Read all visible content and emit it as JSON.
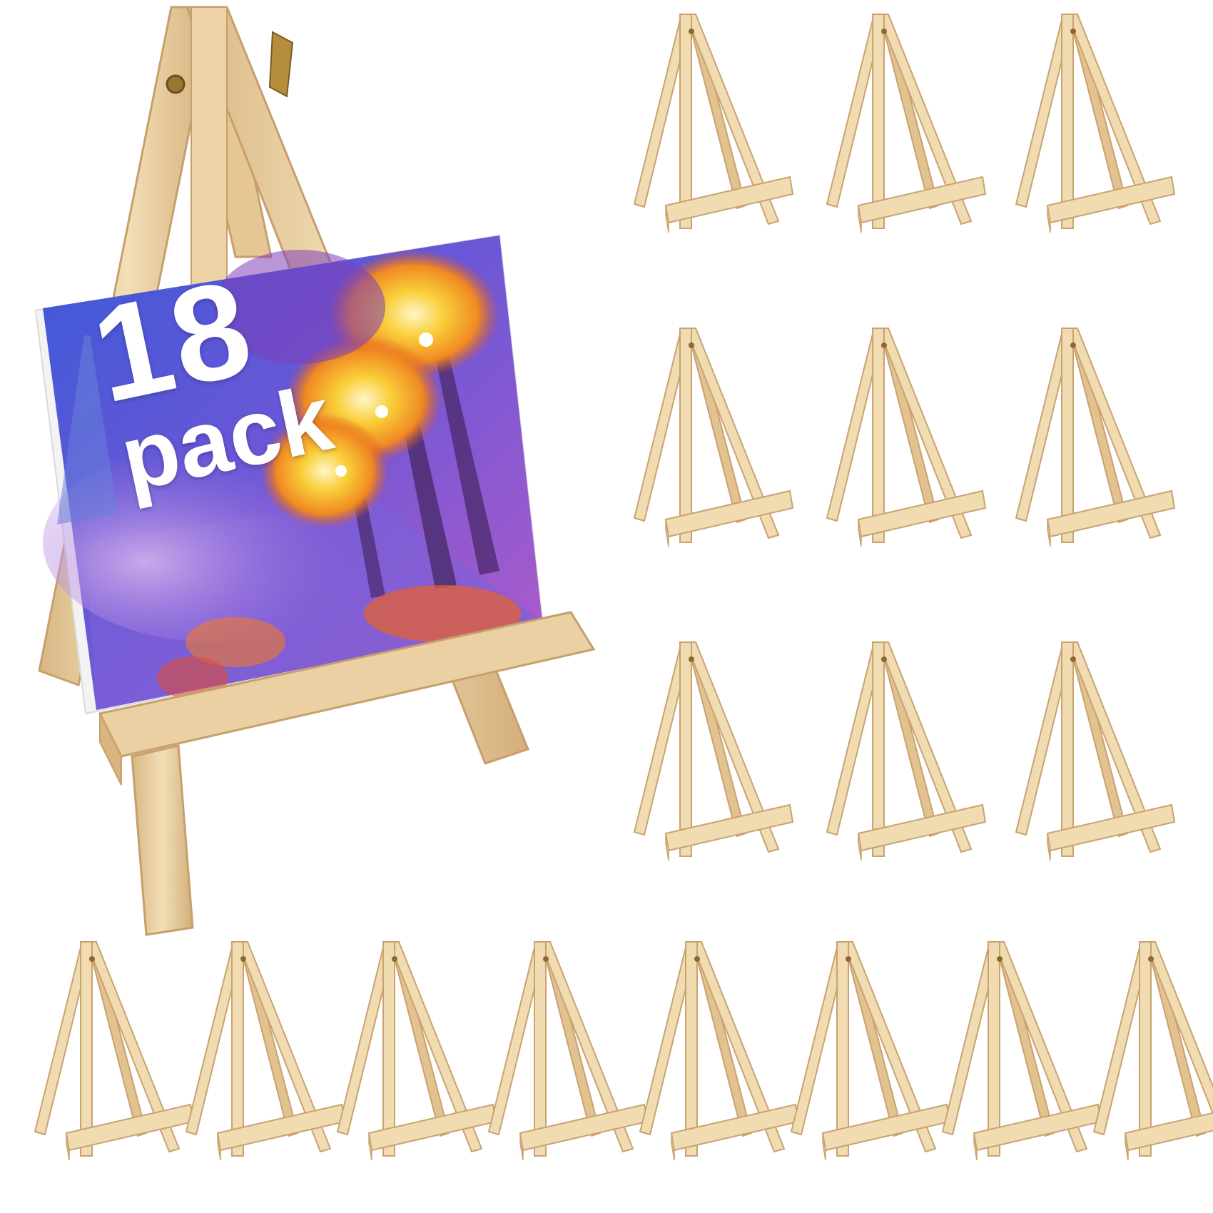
{
  "product": {
    "pack_count": "18",
    "pack_word": "pack"
  },
  "scene": {
    "total_easels": 18,
    "grid_easels": 17,
    "featured_easels": 1
  },
  "colors": {
    "background": "#ffffff",
    "wood_light": "#f1dcb2",
    "wood_mid": "#e2c28f",
    "wood_dark": "#c9a270",
    "hinge": "#8a6a2e",
    "canvas_edge": "#f4f4f4",
    "paint_sky": "#3f4fd6",
    "paint_violet": "#8a4fc4",
    "paint_glow": "#f7c236",
    "paint_orange": "#ee6a22"
  },
  "icons": {
    "easel": "wooden-tabletop-easel-icon",
    "hinge": "brass-hinge-screw-icon",
    "canvas": "painted-canvas-board-icon"
  }
}
